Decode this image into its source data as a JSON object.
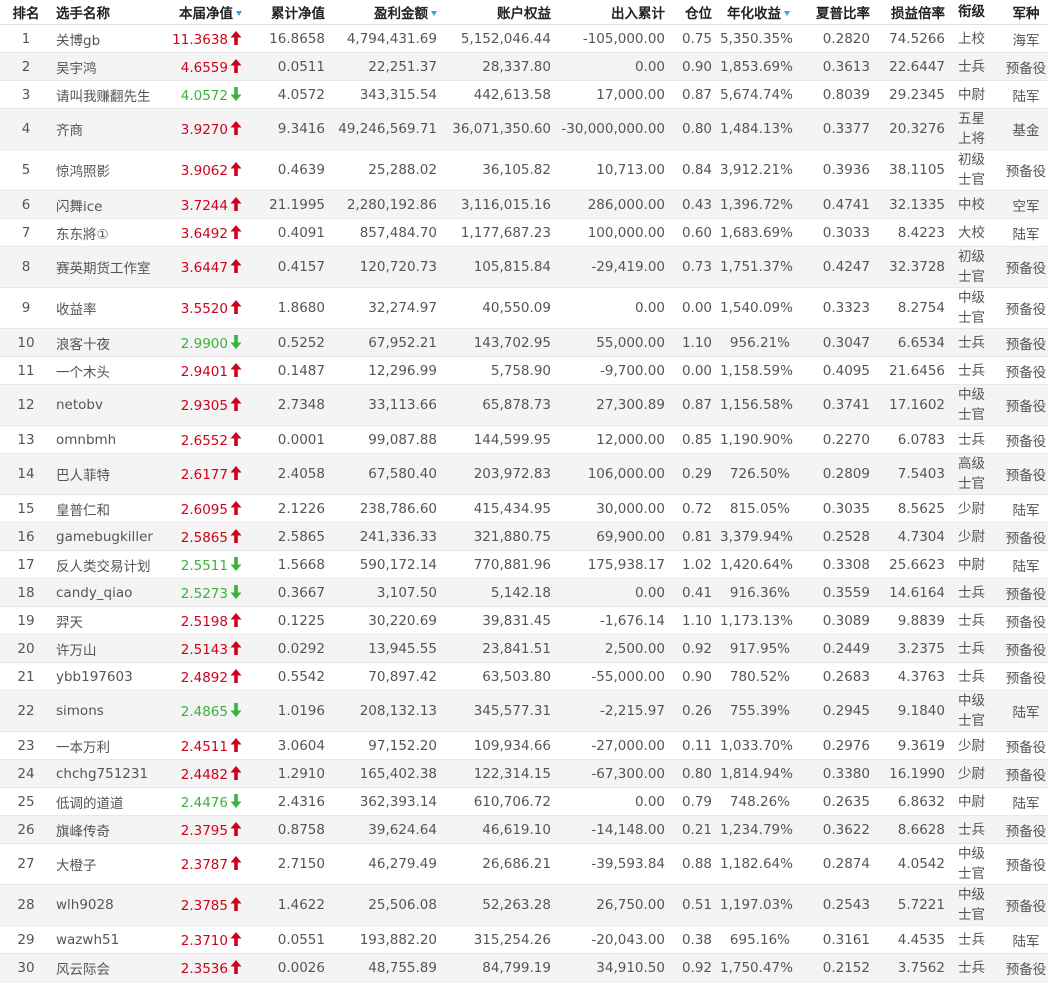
{
  "colors": {
    "up": "#d0021b",
    "down": "#3bb33b",
    "sort_indicator": "#3aa0d8"
  },
  "headers": [
    "排名",
    "选手名称",
    "本届净值",
    "累计净值",
    "盈利金额",
    "账户权益",
    "出入累计",
    "仓位",
    "年化收益",
    "夏普比率",
    "损益倍率",
    "衔级",
    "军种"
  ],
  "sorted_columns": [
    2,
    4,
    8
  ],
  "rows": [
    {
      "rank": "1",
      "name": "关博gb",
      "nav": "11.3638",
      "dir": "up",
      "cum_nav": "16.8658",
      "profit": "4,794,431.69",
      "equity": "5,152,046.44",
      "flow": "-105,000.00",
      "position": "0.75",
      "annual": "5,350.35%",
      "sharpe": "0.2820",
      "pl_ratio": "74.5266",
      "military_rank": "上校",
      "branch": "海军"
    },
    {
      "rank": "2",
      "name": "吴宇鸿",
      "nav": "4.6559",
      "dir": "up",
      "cum_nav": "0.0511",
      "profit": "22,251.37",
      "equity": "28,337.80",
      "flow": "0.00",
      "position": "0.90",
      "annual": "1,853.69%",
      "sharpe": "0.3613",
      "pl_ratio": "22.6447",
      "military_rank": "士兵",
      "branch": "预备役"
    },
    {
      "rank": "3",
      "name": "请叫我赚翻先生",
      "nav": "4.0572",
      "dir": "down",
      "cum_nav": "4.0572",
      "profit": "343,315.54",
      "equity": "442,613.58",
      "flow": "17,000.00",
      "position": "0.87",
      "annual": "5,674.74%",
      "sharpe": "0.8039",
      "pl_ratio": "29.2345",
      "military_rank": "中尉",
      "branch": "陆军"
    },
    {
      "rank": "4",
      "name": "齐商",
      "nav": "3.9270",
      "dir": "up",
      "cum_nav": "9.3416",
      "profit": "49,246,569.71",
      "equity": "36,071,350.60",
      "flow": "-30,000,000.00",
      "position": "0.80",
      "annual": "1,484.13%",
      "sharpe": "0.3377",
      "pl_ratio": "20.3276",
      "military_rank": "五星上将",
      "branch": "基金"
    },
    {
      "rank": "5",
      "name": "惊鸿照影",
      "nav": "3.9062",
      "dir": "up",
      "cum_nav": "0.4639",
      "profit": "25,288.02",
      "equity": "36,105.82",
      "flow": "10,713.00",
      "position": "0.84",
      "annual": "3,912.21%",
      "sharpe": "0.3936",
      "pl_ratio": "38.1105",
      "military_rank": "初级士官",
      "branch": "预备役"
    },
    {
      "rank": "6",
      "name": "闪舞ice",
      "nav": "3.7244",
      "dir": "up",
      "cum_nav": "21.1995",
      "profit": "2,280,192.86",
      "equity": "3,116,015.16",
      "flow": "286,000.00",
      "position": "0.43",
      "annual": "1,396.72%",
      "sharpe": "0.4741",
      "pl_ratio": "32.1335",
      "military_rank": "中校",
      "branch": "空军"
    },
    {
      "rank": "7",
      "name": "东东將①",
      "nav": "3.6492",
      "dir": "up",
      "cum_nav": "0.4091",
      "profit": "857,484.70",
      "equity": "1,177,687.23",
      "flow": "100,000.00",
      "position": "0.60",
      "annual": "1,683.69%",
      "sharpe": "0.3033",
      "pl_ratio": "8.4223",
      "military_rank": "大校",
      "branch": "陆军"
    },
    {
      "rank": "8",
      "name": "赛英期货工作室",
      "nav": "3.6447",
      "dir": "up",
      "cum_nav": "0.4157",
      "profit": "120,720.73",
      "equity": "105,815.84",
      "flow": "-29,419.00",
      "position": "0.73",
      "annual": "1,751.37%",
      "sharpe": "0.4247",
      "pl_ratio": "32.3728",
      "military_rank": "初级士官",
      "branch": "预备役"
    },
    {
      "rank": "9",
      "name": "收益率",
      "nav": "3.5520",
      "dir": "up",
      "cum_nav": "1.8680",
      "profit": "32,274.97",
      "equity": "40,550.09",
      "flow": "0.00",
      "position": "0.00",
      "annual": "1,540.09%",
      "sharpe": "0.3323",
      "pl_ratio": "8.2754",
      "military_rank": "中级士官",
      "branch": "预备役"
    },
    {
      "rank": "10",
      "name": "浪客十夜",
      "nav": "2.9900",
      "dir": "down",
      "cum_nav": "0.5252",
      "profit": "67,952.21",
      "equity": "143,702.95",
      "flow": "55,000.00",
      "position": "1.10",
      "annual": "956.21%",
      "sharpe": "0.3047",
      "pl_ratio": "6.6534",
      "military_rank": "士兵",
      "branch": "预备役"
    },
    {
      "rank": "11",
      "name": "一个木头",
      "nav": "2.9401",
      "dir": "up",
      "cum_nav": "0.1487",
      "profit": "12,296.99",
      "equity": "5,758.90",
      "flow": "-9,700.00",
      "position": "0.00",
      "annual": "1,158.59%",
      "sharpe": "0.4095",
      "pl_ratio": "21.6456",
      "military_rank": "士兵",
      "branch": "预备役"
    },
    {
      "rank": "12",
      "name": "netobv",
      "nav": "2.9305",
      "dir": "up",
      "cum_nav": "2.7348",
      "profit": "33,113.66",
      "equity": "65,878.73",
      "flow": "27,300.89",
      "position": "0.87",
      "annual": "1,156.58%",
      "sharpe": "0.3741",
      "pl_ratio": "17.1602",
      "military_rank": "中级士官",
      "branch": "预备役"
    },
    {
      "rank": "13",
      "name": "omnbmh",
      "nav": "2.6552",
      "dir": "up",
      "cum_nav": "0.0001",
      "profit": "99,087.88",
      "equity": "144,599.95",
      "flow": "12,000.00",
      "position": "0.85",
      "annual": "1,190.90%",
      "sharpe": "0.2270",
      "pl_ratio": "6.0783",
      "military_rank": "士兵",
      "branch": "预备役"
    },
    {
      "rank": "14",
      "name": "巴人菲特",
      "nav": "2.6177",
      "dir": "up",
      "cum_nav": "2.4058",
      "profit": "67,580.40",
      "equity": "203,972.83",
      "flow": "106,000.00",
      "position": "0.29",
      "annual": "726.50%",
      "sharpe": "0.2809",
      "pl_ratio": "7.5403",
      "military_rank": "高级士官",
      "branch": "预备役"
    },
    {
      "rank": "15",
      "name": "皇普仁和",
      "nav": "2.6095",
      "dir": "up",
      "cum_nav": "2.1226",
      "profit": "238,786.60",
      "equity": "415,434.95",
      "flow": "30,000.00",
      "position": "0.72",
      "annual": "815.05%",
      "sharpe": "0.3035",
      "pl_ratio": "8.5625",
      "military_rank": "少尉",
      "branch": "陆军"
    },
    {
      "rank": "16",
      "name": "gamebugkiller",
      "nav": "2.5865",
      "dir": "up",
      "cum_nav": "2.5865",
      "profit": "241,336.33",
      "equity": "321,880.75",
      "flow": "69,900.00",
      "position": "0.81",
      "annual": "3,379.94%",
      "sharpe": "0.2528",
      "pl_ratio": "4.7304",
      "military_rank": "少尉",
      "branch": "预备役"
    },
    {
      "rank": "17",
      "name": "反人类交易计划",
      "nav": "2.5511",
      "dir": "down",
      "cum_nav": "1.5668",
      "profit": "590,172.14",
      "equity": "770,881.96",
      "flow": "175,938.17",
      "position": "1.02",
      "annual": "1,420.64%",
      "sharpe": "0.3308",
      "pl_ratio": "25.6623",
      "military_rank": "中尉",
      "branch": "陆军"
    },
    {
      "rank": "18",
      "name": "candy_qiao",
      "nav": "2.5273",
      "dir": "down",
      "cum_nav": "0.3667",
      "profit": "3,107.50",
      "equity": "5,142.18",
      "flow": "0.00",
      "position": "0.41",
      "annual": "916.36%",
      "sharpe": "0.3559",
      "pl_ratio": "14.6164",
      "military_rank": "士兵",
      "branch": "预备役"
    },
    {
      "rank": "19",
      "name": "羿天",
      "nav": "2.5198",
      "dir": "up",
      "cum_nav": "0.1225",
      "profit": "30,220.69",
      "equity": "39,831.45",
      "flow": "-1,676.14",
      "position": "1.10",
      "annual": "1,173.13%",
      "sharpe": "0.3089",
      "pl_ratio": "9.8839",
      "military_rank": "士兵",
      "branch": "预备役"
    },
    {
      "rank": "20",
      "name": "许万山",
      "nav": "2.5143",
      "dir": "up",
      "cum_nav": "0.0292",
      "profit": "13,945.55",
      "equity": "23,841.51",
      "flow": "2,500.00",
      "position": "0.92",
      "annual": "917.95%",
      "sharpe": "0.2449",
      "pl_ratio": "3.2375",
      "military_rank": "士兵",
      "branch": "预备役"
    },
    {
      "rank": "21",
      "name": "ybb197603",
      "nav": "2.4892",
      "dir": "up",
      "cum_nav": "0.5542",
      "profit": "70,897.42",
      "equity": "63,503.80",
      "flow": "-55,000.00",
      "position": "0.90",
      "annual": "780.52%",
      "sharpe": "0.2683",
      "pl_ratio": "4.3763",
      "military_rank": "士兵",
      "branch": "预备役"
    },
    {
      "rank": "22",
      "name": "simons",
      "nav": "2.4865",
      "dir": "down",
      "cum_nav": "1.0196",
      "profit": "208,132.13",
      "equity": "345,577.31",
      "flow": "-2,215.97",
      "position": "0.26",
      "annual": "755.39%",
      "sharpe": "0.2945",
      "pl_ratio": "9.1840",
      "military_rank": "中级士官",
      "branch": "陆军"
    },
    {
      "rank": "23",
      "name": "一本万利",
      "nav": "2.4511",
      "dir": "up",
      "cum_nav": "3.0604",
      "profit": "97,152.20",
      "equity": "109,934.66",
      "flow": "-27,000.00",
      "position": "0.11",
      "annual": "1,033.70%",
      "sharpe": "0.2976",
      "pl_ratio": "9.3619",
      "military_rank": "少尉",
      "branch": "预备役"
    },
    {
      "rank": "24",
      "name": "chchg751231",
      "nav": "2.4482",
      "dir": "up",
      "cum_nav": "1.2910",
      "profit": "165,402.38",
      "equity": "122,314.15",
      "flow": "-67,300.00",
      "position": "0.80",
      "annual": "1,814.94%",
      "sharpe": "0.3380",
      "pl_ratio": "16.1990",
      "military_rank": "少尉",
      "branch": "预备役"
    },
    {
      "rank": "25",
      "name": "低调的道道",
      "nav": "2.4476",
      "dir": "down",
      "cum_nav": "2.4316",
      "profit": "362,393.14",
      "equity": "610,706.72",
      "flow": "0.00",
      "position": "0.79",
      "annual": "748.26%",
      "sharpe": "0.2635",
      "pl_ratio": "6.8632",
      "military_rank": "中尉",
      "branch": "陆军"
    },
    {
      "rank": "26",
      "name": "旗峰传奇",
      "nav": "2.3795",
      "dir": "up",
      "cum_nav": "0.8758",
      "profit": "39,624.64",
      "equity": "46,619.10",
      "flow": "-14,148.00",
      "position": "0.21",
      "annual": "1,234.79%",
      "sharpe": "0.3622",
      "pl_ratio": "8.6628",
      "military_rank": "士兵",
      "branch": "预备役"
    },
    {
      "rank": "27",
      "name": "大橙子",
      "nav": "2.3787",
      "dir": "up",
      "cum_nav": "2.7150",
      "profit": "46,279.49",
      "equity": "26,686.21",
      "flow": "-39,593.84",
      "position": "0.88",
      "annual": "1,182.64%",
      "sharpe": "0.2874",
      "pl_ratio": "4.0542",
      "military_rank": "中级士官",
      "branch": "预备役"
    },
    {
      "rank": "28",
      "name": "wlh9028",
      "nav": "2.3785",
      "dir": "up",
      "cum_nav": "1.4622",
      "profit": "25,506.08",
      "equity": "52,263.28",
      "flow": "26,750.00",
      "position": "0.51",
      "annual": "1,197.03%",
      "sharpe": "0.2543",
      "pl_ratio": "5.7221",
      "military_rank": "中级士官",
      "branch": "预备役"
    },
    {
      "rank": "29",
      "name": "wazwh51",
      "nav": "2.3710",
      "dir": "up",
      "cum_nav": "0.0551",
      "profit": "193,882.20",
      "equity": "315,254.26",
      "flow": "-20,043.00",
      "position": "0.38",
      "annual": "695.16%",
      "sharpe": "0.3161",
      "pl_ratio": "4.4535",
      "military_rank": "士兵",
      "branch": "陆军"
    },
    {
      "rank": "30",
      "name": "风云际会",
      "nav": "2.3536",
      "dir": "up",
      "cum_nav": "0.0026",
      "profit": "48,755.89",
      "equity": "84,799.19",
      "flow": "34,910.50",
      "position": "0.92",
      "annual": "1,750.47%",
      "sharpe": "0.2152",
      "pl_ratio": "3.7562",
      "military_rank": "士兵",
      "branch": "预备役"
    }
  ]
}
